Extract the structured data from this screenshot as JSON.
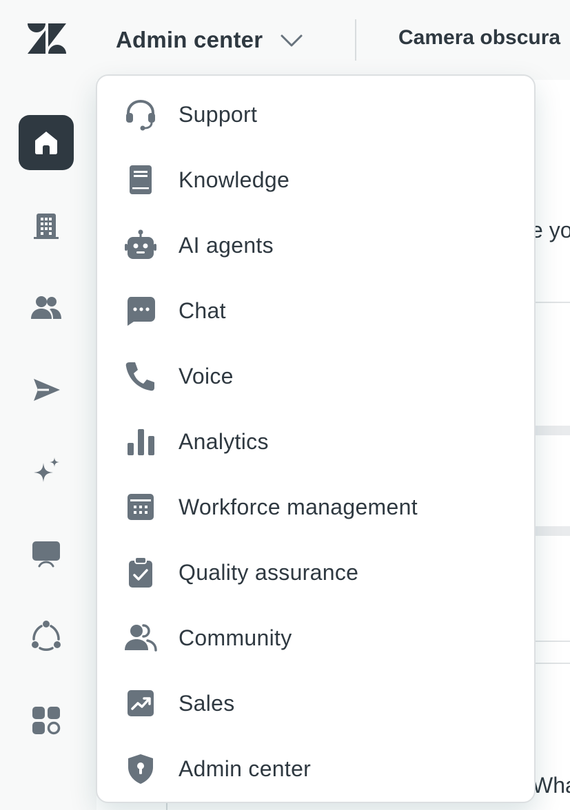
{
  "header": {
    "product_title": "Admin center",
    "account_name": "Camera obscura"
  },
  "colors": {
    "icon": "#68737d",
    "text": "#2f3941",
    "active_nav_bg": "#2f3941",
    "background": "#f8f9f9"
  },
  "sidenav": {
    "items": [
      {
        "name": "home",
        "icon": "home-icon",
        "active": true
      },
      {
        "name": "account",
        "icon": "building-icon",
        "active": false
      },
      {
        "name": "people",
        "icon": "people-icon",
        "active": false
      },
      {
        "name": "channels",
        "icon": "send-icon",
        "active": false
      },
      {
        "name": "ai",
        "icon": "sparkle-icon",
        "active": false
      },
      {
        "name": "workspaces",
        "icon": "monitor-icon",
        "active": false
      },
      {
        "name": "objects-and-rules",
        "icon": "nodes-icon",
        "active": false
      },
      {
        "name": "apps-and-integrations",
        "icon": "apps-icon",
        "active": false
      }
    ]
  },
  "dropdown": {
    "items": [
      {
        "label": "Support",
        "icon": "headset-icon"
      },
      {
        "label": "Knowledge",
        "icon": "book-icon"
      },
      {
        "label": "AI agents",
        "icon": "robot-icon"
      },
      {
        "label": "Chat",
        "icon": "chat-bubble-icon"
      },
      {
        "label": "Voice",
        "icon": "phone-icon"
      },
      {
        "label": "Analytics",
        "icon": "bar-chart-icon"
      },
      {
        "label": "Workforce management",
        "icon": "calendar-icon"
      },
      {
        "label": "Quality assurance",
        "icon": "clipboard-check-icon"
      },
      {
        "label": "Community",
        "icon": "community-icon"
      },
      {
        "label": "Sales",
        "icon": "trend-up-icon"
      },
      {
        "label": "Admin center",
        "icon": "shield-icon"
      }
    ]
  },
  "main": {
    "peek_text_1": "e yo",
    "peek_text_2": "Wha"
  }
}
